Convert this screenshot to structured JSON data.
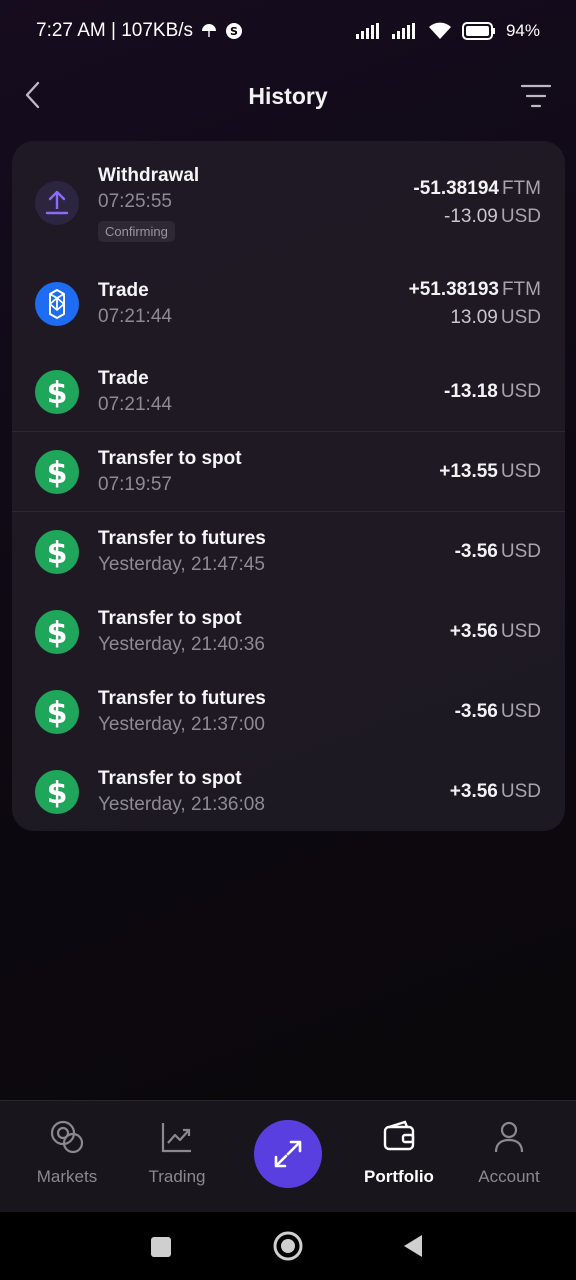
{
  "status_bar": {
    "left_text": "7:27 AM | 107KB/s",
    "battery": "94"
  },
  "header": {
    "title": "History"
  },
  "transactions": [
    {
      "title": "Withdrawal",
      "time": "07:25:55",
      "badge": "Confirming",
      "amount1": "-51.38194",
      "currency1": "FTM",
      "amount2": "-13.09",
      "currency2": "USD",
      "icon": "upload-arrow-icon"
    },
    {
      "title": "Trade",
      "time": "07:21:44",
      "amount1": "+51.38193",
      "currency1": "FTM",
      "amount2": "13.09",
      "currency2": "USD",
      "icon": "fantom-icon"
    },
    {
      "title": "Trade",
      "time": "07:21:44",
      "amount1": "-13.18",
      "currency1": "USD",
      "icon": "dollar-icon"
    },
    {
      "title": "Transfer to spot",
      "time": "07:19:57",
      "amount1": "+13.55",
      "currency1": "USD",
      "icon": "dollar-icon"
    },
    {
      "title": "Transfer to futures",
      "time": "Yesterday, 21:47:45",
      "amount1": "-3.56",
      "currency1": "USD",
      "icon": "dollar-icon"
    },
    {
      "title": "Transfer to spot",
      "time": "Yesterday, 21:40:36",
      "amount1": "+3.56",
      "currency1": "USD",
      "icon": "dollar-icon"
    },
    {
      "title": "Transfer to futures",
      "time": "Yesterday, 21:37:00",
      "amount1": "-3.56",
      "currency1": "USD",
      "icon": "dollar-icon"
    },
    {
      "title": "Transfer to spot",
      "time": "Yesterday, 21:36:08",
      "amount1": "+3.56",
      "currency1": "USD",
      "icon": "dollar-icon"
    }
  ],
  "nav": {
    "markets": "Markets",
    "trading": "Trading",
    "portfolio": "Portfolio",
    "account": "Account",
    "active": "Portfolio"
  },
  "colors": {
    "accent": "#5a3fe0",
    "dollar_green": "#1fa65a",
    "fantom_blue": "#1d6cf2"
  }
}
